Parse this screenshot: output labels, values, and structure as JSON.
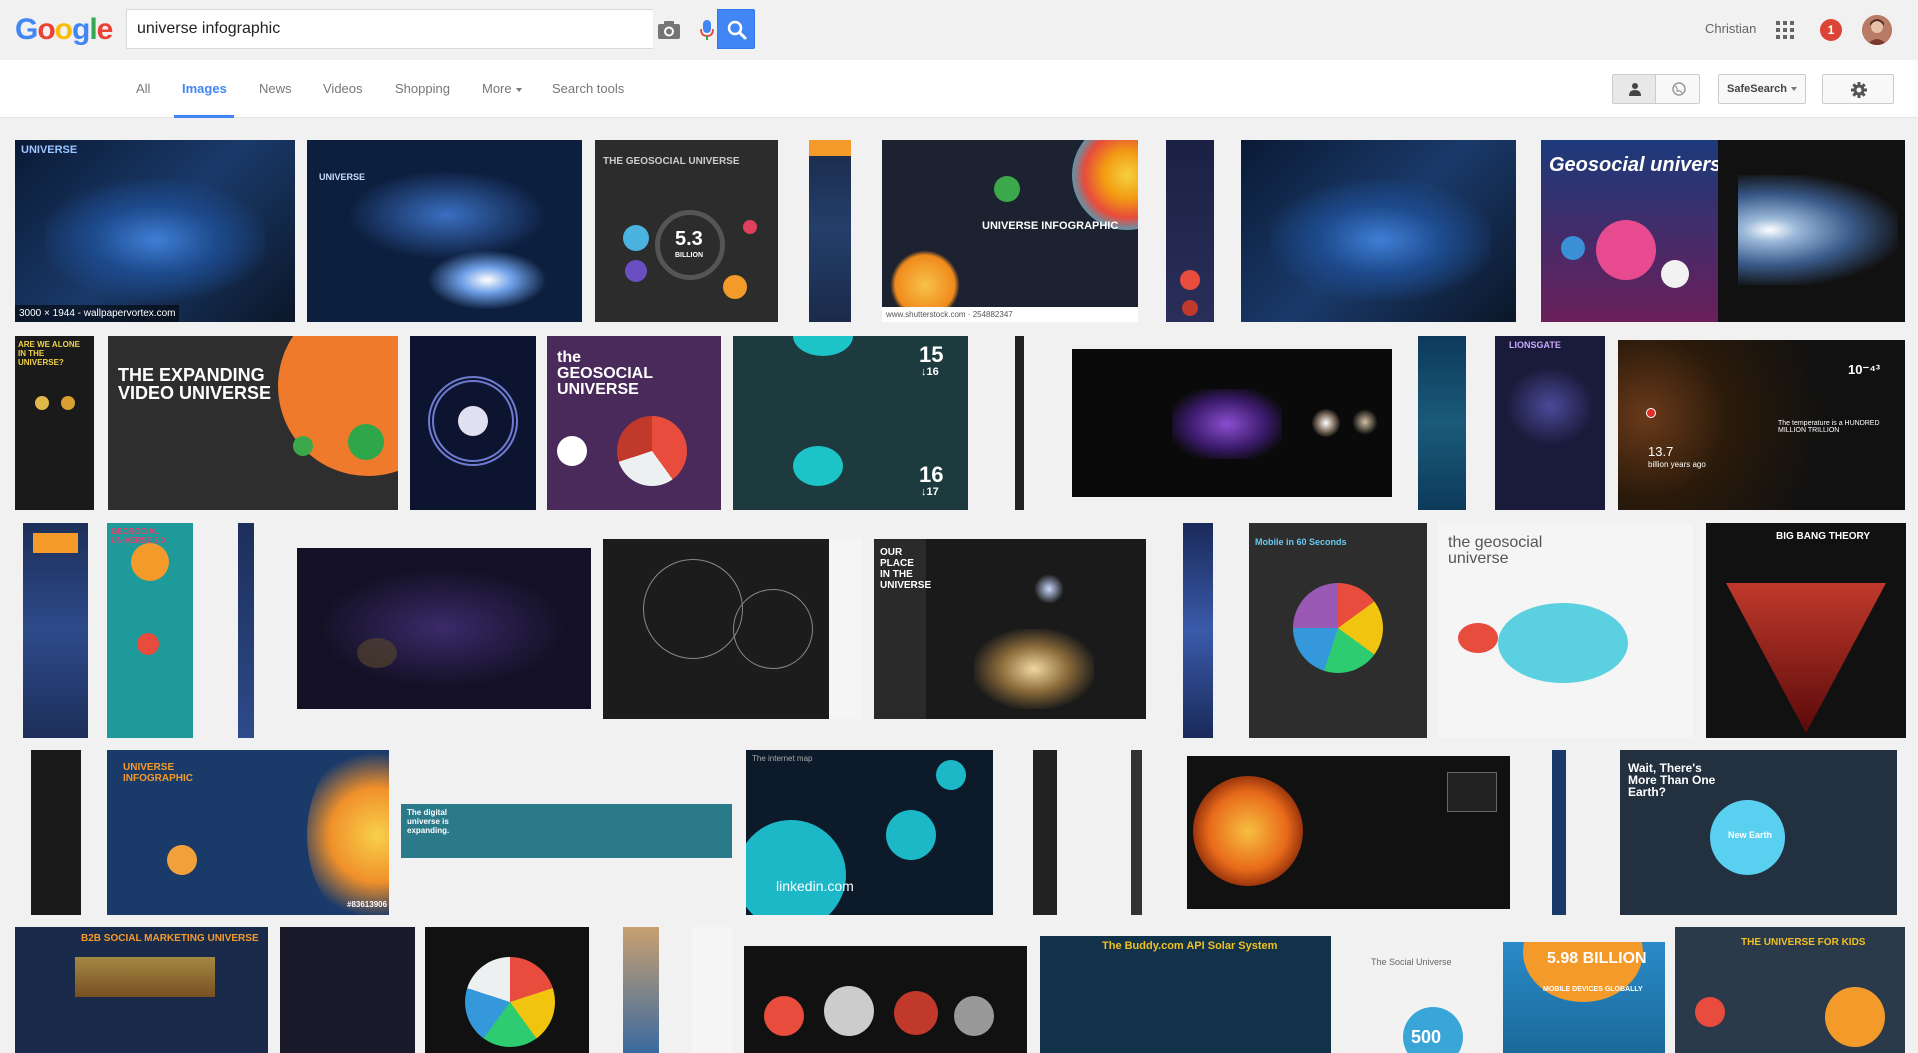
{
  "search": {
    "query": "universe infographic"
  },
  "user": {
    "name": "Christian",
    "notifications": "1"
  },
  "nav": {
    "tabs": [
      {
        "label": "All"
      },
      {
        "label": "Images"
      },
      {
        "label": "News"
      },
      {
        "label": "Videos"
      },
      {
        "label": "Shopping"
      },
      {
        "label": "More"
      },
      {
        "label": "Search tools"
      }
    ],
    "safesearch_label": "SafeSearch"
  },
  "colors": {
    "accent": "#4285f4",
    "badge": "#db4437"
  },
  "thumbnails": {
    "t1_caption": "3000 × 1944 - wallpapervortex.com",
    "t1_label": "UNIVERSE",
    "t2_label": "UNIVERSE",
    "t3_label": "THE GEOSOCIAL UNIVERSE",
    "t3_stat": "5.3",
    "t3_stat_sub": "BILLION",
    "t5_label": "UNIVERSE INFOGRAPHIC",
    "t5_caption": "www.shutterstock.com · 254882347",
    "t8_label": "Geosocial universe",
    "t11_label": "ARE WE ALONE IN THE UNIVERSE?",
    "t12_label": "THE EXPANDING VIDEO UNIVERSE",
    "t14_label": "the GEOSOCIAL UNIVERSE",
    "t15_num1": "15",
    "t15_num1b": "↓16",
    "t15_num2": "16",
    "t15_num2b": "↓17",
    "t19_label": "LIONSGATE",
    "t20_stat": "10⁻⁴³",
    "t20_stat2": "13.7",
    "t20_stat2_sub": "billion years ago",
    "t20_text": "The temperature is a HUNDRED MILLION TRILLION",
    "t22_label": "GEOSOCIAL UNIVERSE 2.0",
    "t26_label": "OUR PLACE IN THE UNIVERSE",
    "t28_label": "Mobile in 60 Seconds",
    "t29_label": "the geosocial universe",
    "t30_label": "BIG BANG THEORY",
    "t32_label": "UNIVERSE INFOGRAPHIC",
    "t32_caption": "#83613906",
    "t33_label": "The digital universe is expanding.",
    "t34_label": "linkedin.com",
    "t34_title": "The internet map",
    "t38_label": "Wait, There's More Than One Earth?",
    "t38_sub": "New Earth",
    "t39_label": "B2B SOCIAL MARKETING UNIVERSE",
    "t42_label": "The Buddy.com API Solar System",
    "t43_label": "The Social Universe",
    "t43_stat": "500",
    "t44_stat": "5.98 BILLION",
    "t44_sub": "MOBILE DEVICES GLOBALLY",
    "t45_label": "THE UNIVERSE FOR KIDS"
  }
}
